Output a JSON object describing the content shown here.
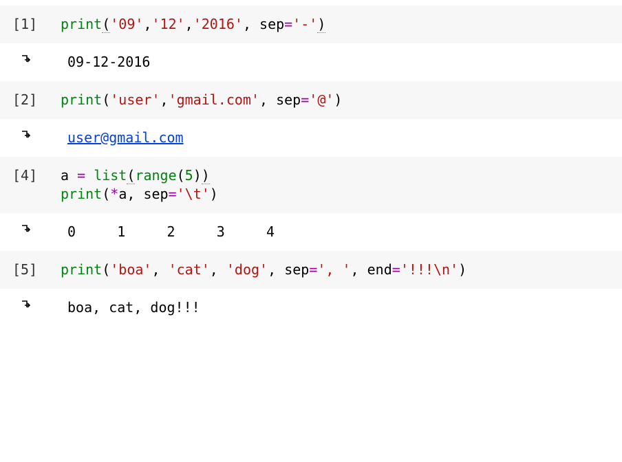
{
  "cells": [
    {
      "prompt": "[1]",
      "code": {
        "fn_print": "print",
        "paren_open": "(",
        "s1": "'09'",
        "comma1": ",",
        "s2": "'12'",
        "comma2": ",",
        "s3": "'2016'",
        "comma3": ",",
        "kw_sep": " sep",
        "eq": "=",
        "sep_val": "'-'",
        "paren_close": ")"
      },
      "output": "09-12-2016"
    },
    {
      "prompt": "[2]",
      "code": {
        "fn_print": "print",
        "paren_open": "(",
        "s1": "'user'",
        "comma1": ",",
        "s2": "'gmail.com'",
        "comma2": ",",
        "kw_sep": " sep",
        "eq": "=",
        "sep_val": "'@'",
        "paren_close": ")"
      },
      "output_link": "user@gmail.com"
    },
    {
      "prompt": "[4]",
      "code": {
        "line1": {
          "id_a": "a ",
          "eq": "=",
          "sp": " ",
          "fn_list": "list",
          "paren_open1": "(",
          "fn_range": "range",
          "paren_open2": "(",
          "num": "5",
          "paren_close2": ")",
          "paren_close1": ")"
        },
        "line2": {
          "fn_print": "print",
          "paren_open": "(",
          "star": "*",
          "id_a": "a",
          "comma": ",",
          "kw_sep": " sep",
          "eq": "=",
          "sep_val": "'\\t'",
          "paren_close": ")"
        }
      },
      "output_tabbed": [
        "0",
        "1",
        "2",
        "3",
        "4"
      ]
    },
    {
      "prompt": "[5]",
      "code": {
        "fn_print": "print",
        "paren_open": "(",
        "s1": "'boa'",
        "comma1": ",",
        "sp1": " ",
        "s2": "'cat'",
        "comma2": ",",
        "sp2": " ",
        "s3": "'dog'",
        "comma3": ",",
        "kw_sep": " sep",
        "eq1": "=",
        "sep_val": "', '",
        "comma4": ",",
        "kw_end": " end",
        "eq2": "=",
        "end_val": "'!!!\\n'",
        "paren_close": ")"
      },
      "output": "boa, cat, dog!!!"
    }
  ]
}
